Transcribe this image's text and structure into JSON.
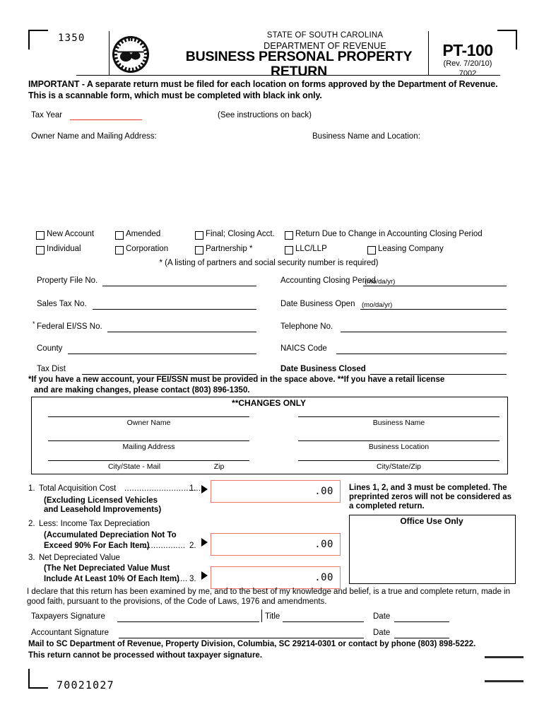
{
  "form": {
    "corner_number": "1350",
    "bottom_number": "70021027",
    "state_line": "STATE OF SOUTH CAROLINA",
    "dept_line": "DEPARTMENT OF REVENUE",
    "title": "BUSINESS PERSONAL PROPERTY RETURN",
    "form_number": "PT-100",
    "revision": "(Rev. 7/20/10)",
    "form_code": "7002",
    "seal_name": "sc-state-seal"
  },
  "important": {
    "line1": "IMPORTANT - A separate return must be filed for each location on forms approved by the Department of Revenue.",
    "line2": "This is a scannable form, which must be completed with black ink only."
  },
  "taxyear": {
    "label": "Tax Year",
    "value": "",
    "instructions": "(See instructions on back)",
    "underline_color": "#e8342b"
  },
  "address": {
    "owner_label": "Owner Name and Mailing Address:",
    "business_label": "Business Name and Location:"
  },
  "checkboxes": {
    "row1": [
      {
        "label": "New Account",
        "checked": false
      },
      {
        "label": "Amended",
        "checked": false
      },
      {
        "label": "Final; Closing Acct.",
        "checked": false
      },
      {
        "label": "Return Due to Change in Accounting Closing Period",
        "checked": false
      }
    ],
    "row2": [
      {
        "label": "Individual",
        "checked": false
      },
      {
        "label": "Corporation",
        "checked": false
      },
      {
        "label": "Partnership *",
        "checked": false
      },
      {
        "label": "LLC/LLP",
        "checked": false
      },
      {
        "label": "Leasing Company",
        "checked": false
      }
    ],
    "footnote": "* (A listing of partners and social security number is required)"
  },
  "fields_left": [
    {
      "label": "Property File No.",
      "value": "",
      "star": false
    },
    {
      "label": "Sales Tax No.",
      "value": "",
      "star": false
    },
    {
      "label": "Federal EI/SS No.",
      "value": "",
      "star": true
    },
    {
      "label": "County",
      "value": "",
      "star": false
    },
    {
      "label": "Tax Dist",
      "value": "",
      "star": false
    }
  ],
  "fields_right": [
    {
      "label": "Accounting Closing Period",
      "hint": "(mo/da/yr)",
      "value": "",
      "bold": false
    },
    {
      "label": "Date Business Open",
      "hint": "(mo/da/yr)",
      "value": "",
      "bold": false
    },
    {
      "label": "Telephone No.",
      "hint": "",
      "value": "",
      "bold": false
    },
    {
      "label": "NAICS Code",
      "hint": "",
      "value": "",
      "bold": false
    },
    {
      "label": "Date Business Closed",
      "hint": "",
      "value": "",
      "bold": true
    }
  ],
  "fei_note": {
    "line1": "*If you have a new account, your FEI/SSN must be provided in the space above.  **If you have a retail license",
    "line2": "and are making changes, please contact (803) 896-1350."
  },
  "changes_only": {
    "title": "**CHANGES ONLY",
    "left": [
      {
        "caption": "Owner Name",
        "value": ""
      },
      {
        "caption": "Mailing Address",
        "value": ""
      },
      {
        "caption": "City/State - Mail",
        "caption2": "Zip",
        "value": ""
      }
    ],
    "right": [
      {
        "caption": "Business Name",
        "value": ""
      },
      {
        "caption": "Business Location",
        "value": ""
      },
      {
        "caption": "City/State/Zip",
        "value": ""
      }
    ]
  },
  "lines": [
    {
      "number": "1.",
      "title": "Total Acquisition Cost",
      "leader": "...............................",
      "sub": [
        "(Excluding Licensed Vehicles",
        "and Leasehold Improvements)"
      ],
      "box_number": "1.",
      "value": "",
      "cents": ".00"
    },
    {
      "number": "2.",
      "title": "Less: Income Tax Depreciation",
      "leader": ".................",
      "sub": [
        "(Accumulated Depreciation Not To",
        "Exceed 90% For Each Item)"
      ],
      "box_number": "2.",
      "value": "",
      "cents": ".00"
    },
    {
      "number": "3.",
      "title": "Net Depreciated Value",
      "leader": ".....",
      "sub": [
        "(The Net Depreciated Value Must",
        "Include At Least 10% Of Each Item)"
      ],
      "box_number": "3.",
      "value": "",
      "cents": ".00"
    }
  ],
  "side_note": {
    "line1": "Lines 1, 2, and 3 must be completed.  The",
    "line2": "preprinted zeros will not be considered as",
    "line3": "a completed return."
  },
  "office_use": {
    "title": "Office Use Only"
  },
  "declaration": {
    "line1": "I declare that this return has been examined by me, and to the best of my knowledge and belief, is a true and complete return, made in",
    "line2": "good faith, pursuant to the provisions, of the Code of Laws, 1976 and amendments."
  },
  "signatures": {
    "taxpayer_label": "Taxpayers Signature",
    "title_label": "Title",
    "date_label_1": "Date",
    "accountant_label": "Accountant Signature",
    "date_label_2": "Date",
    "taxpayer_value": "",
    "title_value": "",
    "date_value_1": "",
    "accountant_value": "",
    "date_value_2": ""
  },
  "mail_note": {
    "line1": "Mail to SC Department of Revenue, Property Division, Columbia, SC  29214-0301 or contact by phone (803) 898-5222.",
    "line2": "This return cannot be processed without taxpayer signature."
  },
  "colors": {
    "accent_red": "#e8342b",
    "box_red": "#f0756c",
    "ink": "#000000"
  }
}
